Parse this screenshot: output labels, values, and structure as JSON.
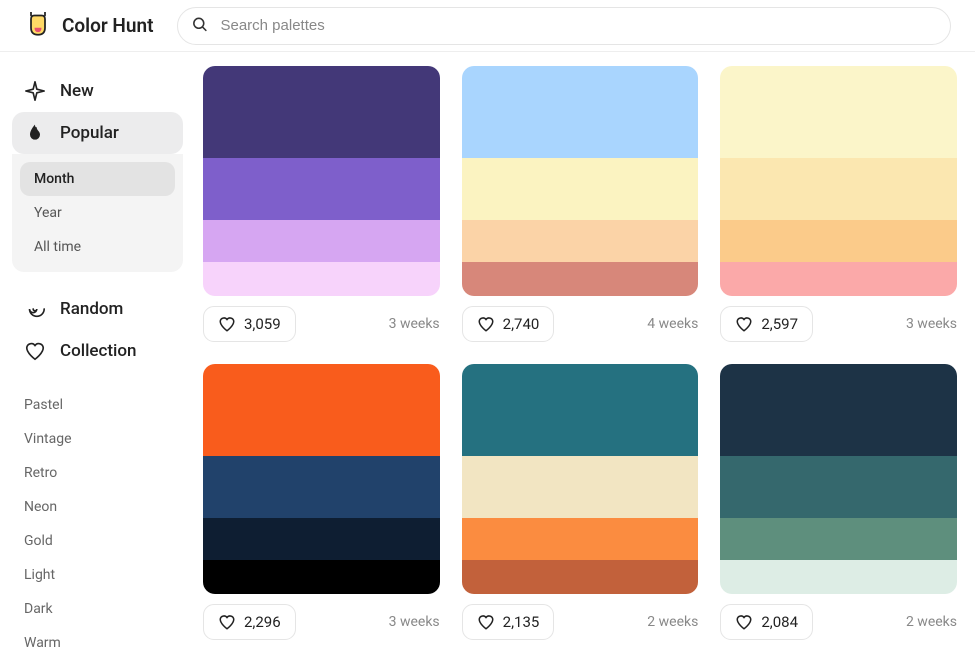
{
  "header": {
    "logo_text": "Color Hunt",
    "search_placeholder": "Search palettes"
  },
  "sidebar": {
    "nav": [
      {
        "label": "New",
        "key": "new"
      },
      {
        "label": "Popular",
        "key": "popular"
      },
      {
        "label": "Random",
        "key": "random"
      },
      {
        "label": "Collection",
        "key": "collection"
      }
    ],
    "popular_sub": [
      {
        "label": "Month",
        "active": true
      },
      {
        "label": "Year",
        "active": false
      },
      {
        "label": "All time",
        "active": false
      }
    ],
    "tags": [
      "Pastel",
      "Vintage",
      "Retro",
      "Neon",
      "Gold",
      "Light",
      "Dark",
      "Warm"
    ]
  },
  "palettes": [
    {
      "colors": [
        "#433878",
        "#7E5FCB",
        "#D6A6F2",
        "#F7D3FB"
      ],
      "likes": "3,059",
      "age": "3 weeks"
    },
    {
      "colors": [
        "#A9D5FE",
        "#FBF3C1",
        "#FBD3A7",
        "#D7877A"
      ],
      "likes": "2,740",
      "age": "4 weeks"
    },
    {
      "colors": [
        "#FBF5C9",
        "#FBE7B0",
        "#FBCB8A",
        "#FBA9A9"
      ],
      "likes": "2,597",
      "age": "3 weeks"
    },
    {
      "colors": [
        "#F95C1C",
        "#21426B",
        "#0E1E32",
        "#000000"
      ],
      "likes": "2,296",
      "age": "3 weeks"
    },
    {
      "colors": [
        "#257180",
        "#F2E5C2",
        "#FB8C40",
        "#C2613B"
      ],
      "likes": "2,135",
      "age": "2 weeks"
    },
    {
      "colors": [
        "#1D3346",
        "#35686D",
        "#5E8F7D",
        "#DDEDE5"
      ],
      "likes": "2,084",
      "age": "2 weeks"
    }
  ]
}
